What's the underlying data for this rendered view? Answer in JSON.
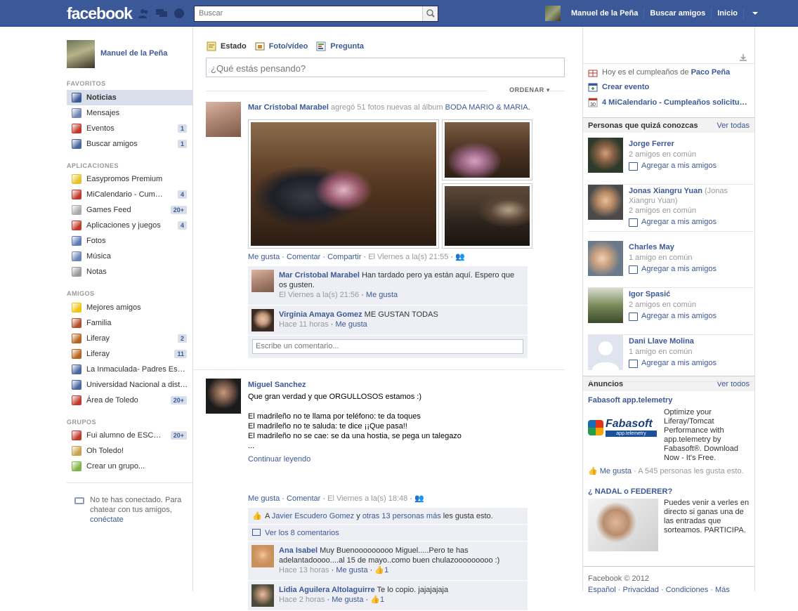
{
  "topbar": {
    "logo": "facebook",
    "search_placeholder": "Buscar",
    "user_name": "Manuel de la Peña",
    "find_friends": "Buscar amigos",
    "home": "Inicio"
  },
  "left": {
    "profile_name": "Manuel de la Peña",
    "sections": {
      "favorites": "FAVORITOS",
      "apps": "APLICACIONES",
      "friends": "AMIGOS",
      "groups": "GRUPOS"
    },
    "favorites": [
      {
        "label": "Noticias",
        "count": ""
      },
      {
        "label": "Mensajes",
        "count": ""
      },
      {
        "label": "Eventos",
        "count": "1"
      },
      {
        "label": "Buscar amigos",
        "count": "1"
      }
    ],
    "apps": [
      {
        "label": "Easypromos Premium",
        "count": ""
      },
      {
        "label": "MiCalendario - Cum…",
        "count": "4"
      },
      {
        "label": "Games Feed",
        "count": "20+"
      },
      {
        "label": "Aplicaciones y juegos",
        "count": "4"
      },
      {
        "label": "Fotos",
        "count": ""
      },
      {
        "label": "Música",
        "count": ""
      },
      {
        "label": "Notas",
        "count": ""
      }
    ],
    "friends": [
      {
        "label": "Mejores amigos",
        "count": ""
      },
      {
        "label": "Familia",
        "count": ""
      },
      {
        "label": "Liferay",
        "count": "2"
      },
      {
        "label": "Liferay",
        "count": "11"
      },
      {
        "label": "La Inmaculada- Padres Es…",
        "count": ""
      },
      {
        "label": "Universidad Nacional a dist…",
        "count": ""
      },
      {
        "label": "Área de Toledo",
        "count": "20+"
      }
    ],
    "groups": [
      {
        "label": "Fui alumno de ESC…",
        "count": "20+"
      },
      {
        "label": "Oh Toledo!",
        "count": ""
      },
      {
        "label": "Crear un grupo...",
        "count": ""
      }
    ],
    "chat_text": "No te has conectado. Para chatear con tus amigos,",
    "chat_link": "conéctate"
  },
  "composer": {
    "tab_status": "Estado",
    "tab_photo": "Foto/vídeo",
    "tab_question": "Pregunta",
    "placeholder": "¿Qué estás pensando?",
    "sort": "ORDENAR"
  },
  "story1": {
    "author": "Mar Cristobal Marabel",
    "action": "agregó 51 fotos nuevas al álbum",
    "album": "BODA MARIO & MARIA",
    "like": "Me gusta",
    "comment": "Comentar",
    "share": "Compartir",
    "time": "El Viernes a la(s) 21:55",
    "comments": [
      {
        "author": "Mar Cristobal Marabel",
        "text": "Han tardado pero ya están aquí. Espero que os gusten.",
        "time": "El Viernes a la(s) 21:56",
        "like": "Me gusta"
      },
      {
        "author": "Virginia Amaya Gomez",
        "text": "ME GUSTAN TODAS",
        "time": "Hace 11 horas",
        "like": "Me gusta"
      }
    ],
    "write_placeholder": "Escribe un comentario..."
  },
  "story2": {
    "author": "Miguel Sanchez",
    "line1": "Que gran verdad y que ORGULLOSOS estamos :)",
    "line2": "El madrileño no te llama por teléfono: te da toques",
    "line3": "El madrileño no te saluda: te dice ¡¡Que pasa!!",
    "line4": "El madrileño no se cae: se da una hostia, se pega un talegazo",
    "line5": "...",
    "more": "Continuar leyendo",
    "like": "Me gusta",
    "comment": "Comentar",
    "time": "El Viernes a la(s) 18:48",
    "likes_a": "A",
    "likes_person": "Javier Escudero Gomez",
    "likes_and": "y",
    "likes_others": "otras 13 personas más",
    "likes_tail": "les gusta esto.",
    "view_comments": "Ver los 8 comentarios",
    "comments": [
      {
        "author": "Ana Isabel",
        "text": "Muy Buenooooooooo Miguel.....Pero te has adelantadoooo....al 15 de mayo..como buen chulazooooooooo :)",
        "time": "Hace 13 horas",
        "like": "Me gusta",
        "likes": "1"
      },
      {
        "author": "Lidia Aguilera Altolaguirre",
        "text": "Te lo copio. jajajajaja",
        "time": "Hace 2 horas",
        "like": "Me gusta",
        "likes": "1"
      }
    ]
  },
  "right": {
    "birthday_prefix": "Hoy es el cumpleaños de",
    "birthday_name": "Paco Peña",
    "create_event": "Crear evento",
    "calendar": "4 MiCalendario - Cumpleaños solicitu…",
    "pymk_title": "Personas que quizá conozcas",
    "see_all": "Ver todas",
    "add_label": "Agregar a mis amigos",
    "people": [
      {
        "name": "Jorge Ferrer",
        "alt": "",
        "mutual": "2 amigos en común"
      },
      {
        "name": "Jonas Xiangru Yuan",
        "alt": "(Jonas Xiangru Yuan)",
        "mutual": "2 amigos en común"
      },
      {
        "name": "Charles May",
        "alt": "",
        "mutual": "1 amigo en común"
      },
      {
        "name": "Igor Spasić",
        "alt": "",
        "mutual": "2 amigos en común"
      },
      {
        "name": "Dani Llave Molina",
        "alt": "",
        "mutual": "1 amigo en común"
      }
    ],
    "ads_title": "Anuncios",
    "ads_see_all": "Ver todos",
    "ad1": {
      "title": "Fabasoft app.telemetry",
      "logo": "Fabasoft",
      "logo_sub": "app.telemetry",
      "text": "Optimize your Liferay/Tomcat Performance with app.telemetry by Fabasoft®. Download Now - It's Free.",
      "like": "Me gusta",
      "likes": "· A 545 personas les gusta esto."
    },
    "ad2": {
      "title": "¿ NADAL o FEDERER?",
      "text": "Puedes venir a verles en directo si ganas una de las entradas que sorteamos. PARTICIPA."
    },
    "footer": "Facebook © 2012",
    "footer2": "Español · Privacidad · Condiciones · Más"
  }
}
